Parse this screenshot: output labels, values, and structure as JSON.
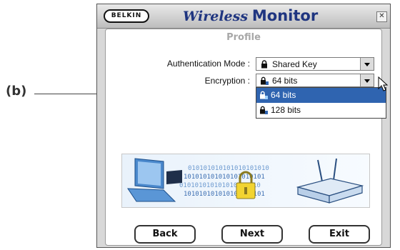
{
  "annotation": {
    "callout_label": "(b)"
  },
  "window": {
    "brand": "BELKIN",
    "title_part1": "Wireless",
    "title_part2": "Monitor",
    "close_glyph": "✕"
  },
  "profile": {
    "heading": "Profile",
    "authentication_mode": {
      "label": "Authentication Mode :",
      "value": "Shared Key",
      "icon": "lock-icon"
    },
    "encryption": {
      "label": "Encryption :",
      "value": "64 bits",
      "icon": "lock-64-icon"
    }
  },
  "encryption_dropdown": {
    "options": [
      {
        "label": "64 bits",
        "icon": "lock-64-icon",
        "key_size": "64",
        "selected": true
      },
      {
        "label": "128 bits",
        "icon": "lock-128-icon",
        "key_size": "128",
        "selected": false
      }
    ]
  },
  "banner": {
    "binary_lines": [
      "010101010101010101010",
      "101010101010101010101",
      "010101010101010101010",
      "101010101010101010101"
    ],
    "icons": [
      "laptop-icon",
      "padlock-icon",
      "router-icon"
    ]
  },
  "buttons": {
    "back": "Back",
    "next": "Next",
    "exit": "Exit"
  },
  "colors": {
    "title": "#1f3580",
    "selection": "#2f64b0",
    "heading": "#a8a8a8"
  }
}
